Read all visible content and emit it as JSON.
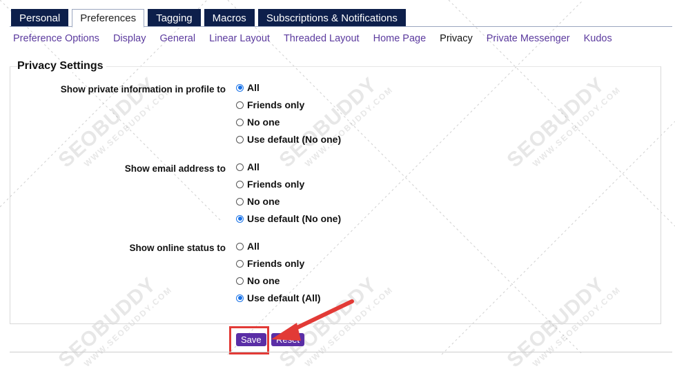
{
  "tabs": [
    {
      "label": "Personal",
      "active": false
    },
    {
      "label": "Preferences",
      "active": true
    },
    {
      "label": "Tagging",
      "active": false
    },
    {
      "label": "Macros",
      "active": false
    },
    {
      "label": "Subscriptions & Notifications",
      "active": false
    }
  ],
  "subnav": [
    {
      "label": "Preference Options",
      "current": false
    },
    {
      "label": "Display",
      "current": false
    },
    {
      "label": "General",
      "current": false
    },
    {
      "label": "Linear Layout",
      "current": false
    },
    {
      "label": "Threaded Layout",
      "current": false
    },
    {
      "label": "Home Page",
      "current": false
    },
    {
      "label": "Privacy",
      "current": true
    },
    {
      "label": "Private Messenger",
      "current": false
    },
    {
      "label": "Kudos",
      "current": false
    }
  ],
  "panel": {
    "title": "Privacy Settings",
    "groups": [
      {
        "label": "Show private information in profile to",
        "options": [
          "All",
          "Friends only",
          "No one",
          "Use default (No one)"
        ],
        "selected": 0
      },
      {
        "label": "Show email address to",
        "options": [
          "All",
          "Friends only",
          "No one",
          "Use default (No one)"
        ],
        "selected": 3
      },
      {
        "label": "Show online status to",
        "options": [
          "All",
          "Friends only",
          "No one",
          "Use default (All)"
        ],
        "selected": 3
      }
    ]
  },
  "buttons": {
    "save": "Save",
    "reset": "Reset"
  },
  "watermark": {
    "brand": "SEOBUDDY",
    "site": "WWW.SEOBUDDY.COM"
  },
  "colors": {
    "tab_bg": "#0d1f4b",
    "link": "#5b3a9e",
    "button": "#5a2ea6",
    "highlight": "#e23a36",
    "arrow": "#e23a36",
    "radio_checked": "#1a73e8"
  }
}
